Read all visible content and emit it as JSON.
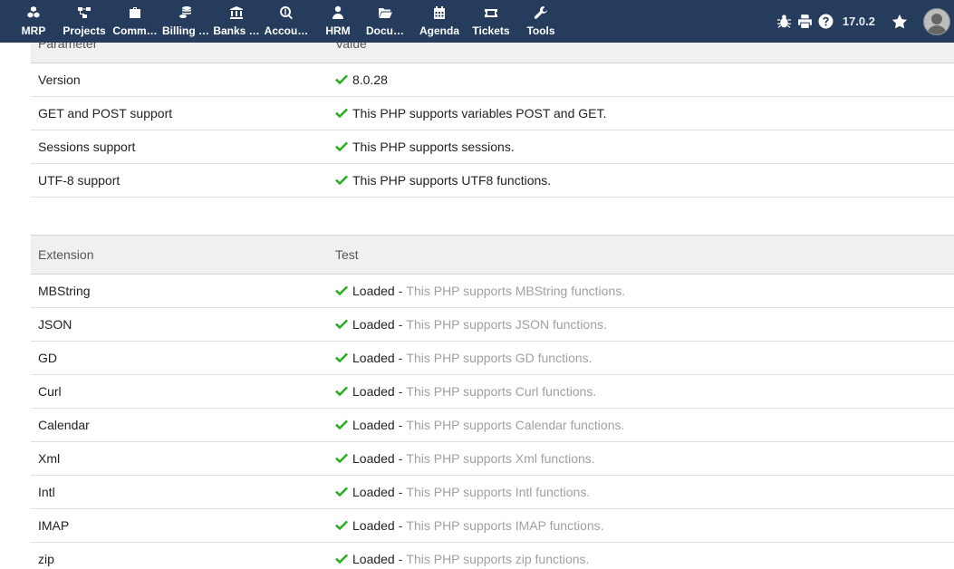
{
  "menu": [
    {
      "label": "MRP",
      "icon": "cubes-icon"
    },
    {
      "label": "Projects",
      "icon": "project-diagram-icon"
    },
    {
      "label": "Comm…",
      "icon": "briefcase-icon"
    },
    {
      "label": "Billing …",
      "icon": "coins-icon"
    },
    {
      "label": "Banks …",
      "icon": "bank-icon"
    },
    {
      "label": "Accou…",
      "icon": "search-dollar-icon"
    },
    {
      "label": "HRM",
      "icon": "user-tie-icon"
    },
    {
      "label": "Docu…",
      "icon": "folder-open-icon"
    },
    {
      "label": "Agenda",
      "icon": "calendar-icon"
    },
    {
      "label": "Tickets",
      "icon": "ticket-icon"
    },
    {
      "label": "Tools",
      "icon": "wrench-icon"
    }
  ],
  "toolbar": {
    "version": "17.0.2"
  },
  "php_table": {
    "header": {
      "col1": "Parameter",
      "col2": "Value"
    },
    "rows": [
      {
        "name": "Version",
        "value": "8.0.28"
      },
      {
        "name": "GET and POST support",
        "value": "This PHP supports variables POST and GET."
      },
      {
        "name": "Sessions support",
        "value": "This PHP supports sessions."
      },
      {
        "name": "UTF-8 support",
        "value": "This PHP supports UTF8 functions."
      }
    ]
  },
  "ext_table": {
    "header": {
      "col1": "Extension",
      "col2": "Test"
    },
    "status_label": "Loaded",
    "rows": [
      {
        "name": "MBString",
        "desc": "This PHP supports MBString functions."
      },
      {
        "name": "JSON",
        "desc": "This PHP supports JSON functions."
      },
      {
        "name": "GD",
        "desc": "This PHP supports GD functions."
      },
      {
        "name": "Curl",
        "desc": "This PHP supports Curl functions."
      },
      {
        "name": "Calendar",
        "desc": "This PHP supports Calendar functions."
      },
      {
        "name": "Xml",
        "desc": "This PHP supports Xml functions."
      },
      {
        "name": "Intl",
        "desc": "This PHP supports Intl functions."
      },
      {
        "name": "IMAP",
        "desc": "This PHP supports IMAP functions."
      },
      {
        "name": "zip",
        "desc": "This PHP supports zip functions."
      }
    ]
  },
  "colors": {
    "topbar": "#263c5c",
    "check": "#27ae1e",
    "muted_text": "#a0a0a0"
  }
}
